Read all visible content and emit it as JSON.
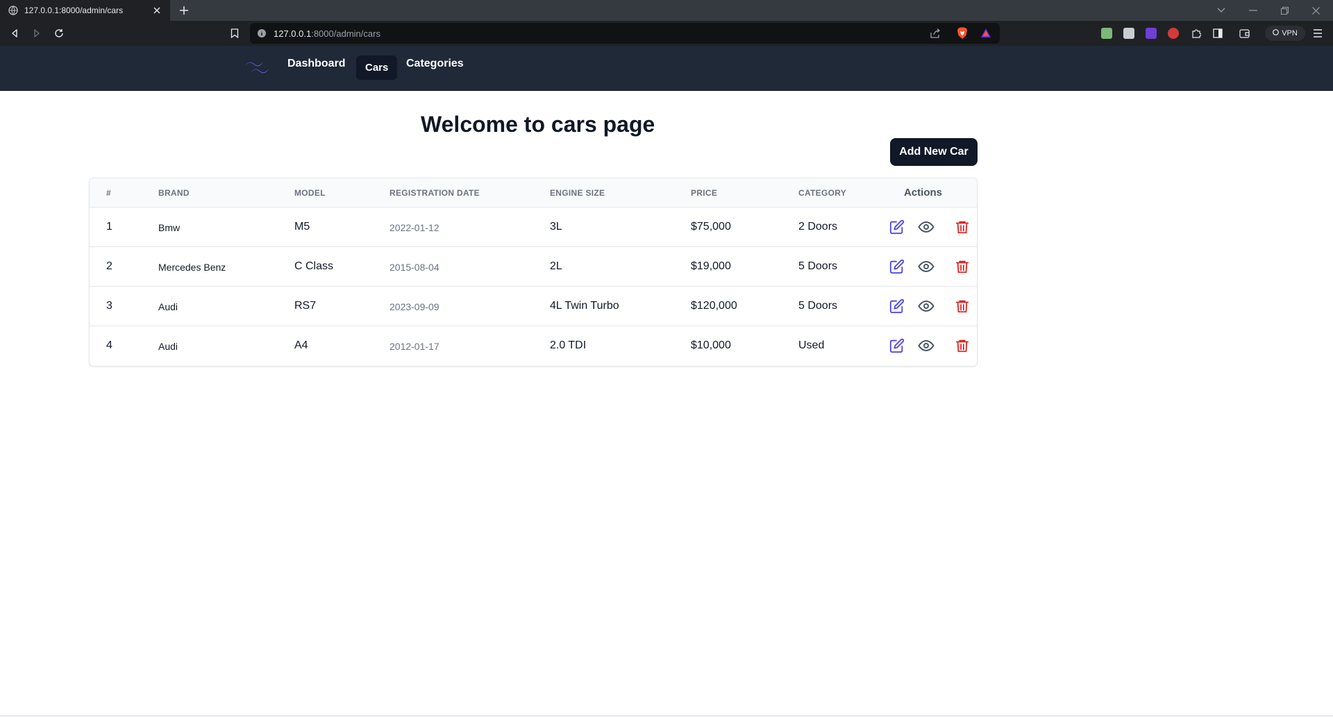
{
  "browser": {
    "tab_title": "127.0.0.1:8000/admin/cars",
    "url_host": "127.0.0.1",
    "url_path": ":8000/admin/cars",
    "vpn_label": "VPN"
  },
  "nav": {
    "items": [
      {
        "label": "Dashboard"
      },
      {
        "label": "Cars"
      },
      {
        "label": "Categories"
      }
    ],
    "active": "Cars"
  },
  "page": {
    "title": "Welcome to cars page",
    "add_button": "Add New Car"
  },
  "table": {
    "columns": [
      "#",
      "Brand",
      "Model",
      "Registration Date",
      "Engine Size",
      "Price",
      "Category",
      "Actions"
    ],
    "rows": [
      {
        "id": "1",
        "brand": "Bmw",
        "model": "M5",
        "date": "2022-01-12",
        "engine": "3L",
        "price": "$75,000",
        "category": "2 Doors"
      },
      {
        "id": "2",
        "brand": "Mercedes Benz",
        "model": "C Class",
        "date": "2015-08-04",
        "engine": "2L",
        "price": "$19,000",
        "category": "5 Doors"
      },
      {
        "id": "3",
        "brand": "Audi",
        "model": "RS7",
        "date": "2023-09-09",
        "engine": "4L Twin Turbo",
        "price": "$120,000",
        "category": "5 Doors"
      },
      {
        "id": "4",
        "brand": "Audi",
        "model": "A4",
        "date": "2012-01-17",
        "engine": "2.0 TDI",
        "price": "$10,000",
        "category": "Used"
      }
    ],
    "row_actions": [
      "edit-icon",
      "eye-icon",
      "trash-icon"
    ]
  },
  "colors": {
    "nav_bg": "#1f2937",
    "active_nav_bg": "#111827",
    "primary_button": "#111827",
    "edit_icon": "#4f46e5",
    "view_icon": "#4b5563",
    "delete_icon": "#dc2626",
    "logo": "#6366f1"
  }
}
